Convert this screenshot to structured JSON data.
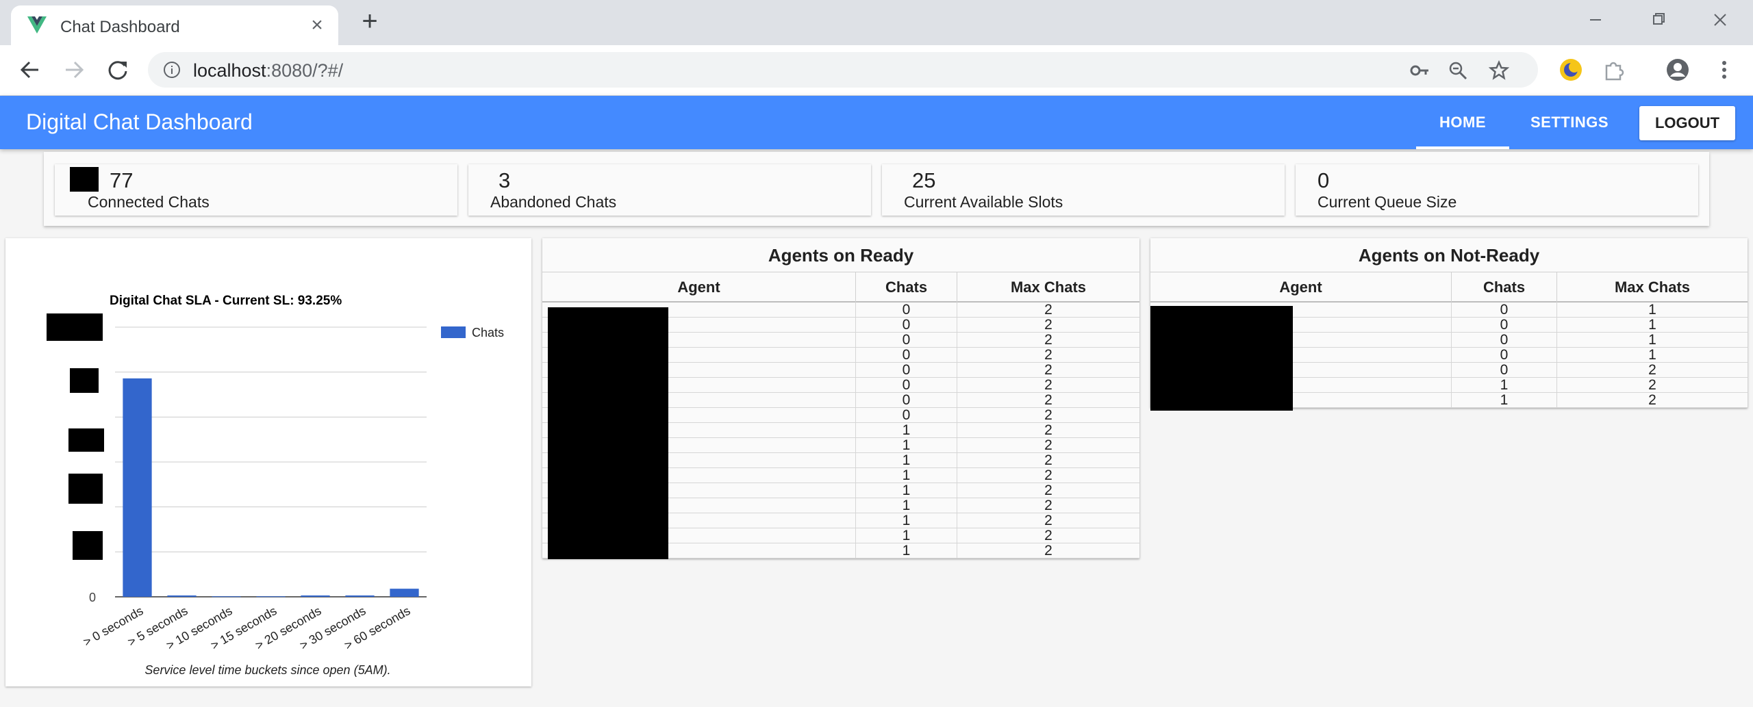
{
  "browser": {
    "tab_title": "Chat Dashboard",
    "url_host": "localhost",
    "url_rest": ":8080/?#/"
  },
  "app": {
    "title": "Digital Chat Dashboard",
    "nav": {
      "home": "HOME",
      "settings": "SETTINGS",
      "logout": "LOGOUT"
    },
    "accent": "#448aff"
  },
  "stats": [
    {
      "value": "77",
      "label": "Connected Chats"
    },
    {
      "value": "3",
      "label": "Abandoned Chats"
    },
    {
      "value": "25",
      "label": "Current Available Slots"
    },
    {
      "value": "0",
      "label": "Current Queue Size"
    }
  ],
  "chart_data": {
    "type": "bar",
    "title": "Digital Chat SLA - Current SL: 93.25%",
    "xlabel": "Service level time buckets since open (5AM).",
    "ylabel": "",
    "categories": [
      "> 0 seconds",
      "> 5 seconds",
      "> 10 seconds",
      "> 15 seconds",
      "> 20 seconds",
      "> 30 seconds",
      "> 60 seconds"
    ],
    "series": [
      {
        "name": "Chats",
        "values": [
          81,
          0.5,
          0.2,
          0.2,
          0.5,
          0.5,
          3
        ],
        "color": "#3366cc"
      }
    ],
    "ylim": [
      0,
      100
    ],
    "y_tick_labels": [
      "0"
    ],
    "grid": true,
    "legend": "right"
  },
  "ready_table": {
    "title": "Agents on Ready",
    "headers": [
      "Agent",
      "Chats",
      "Max Chats"
    ],
    "rows": [
      [
        "0",
        "2"
      ],
      [
        "0",
        "2"
      ],
      [
        "0",
        "2"
      ],
      [
        "0",
        "2"
      ],
      [
        "0",
        "2"
      ],
      [
        "0",
        "2"
      ],
      [
        "0",
        "2"
      ],
      [
        "0",
        "2"
      ],
      [
        "1",
        "2"
      ],
      [
        "1",
        "2"
      ],
      [
        "1",
        "2"
      ],
      [
        "1",
        "2"
      ],
      [
        "1",
        "2"
      ],
      [
        "1",
        "2"
      ],
      [
        "1",
        "2"
      ],
      [
        "1",
        "2"
      ],
      [
        "1",
        "2"
      ]
    ]
  },
  "notready_table": {
    "title": "Agents on Not-Ready",
    "headers": [
      "Agent",
      "Chats",
      "Max Chats"
    ],
    "rows": [
      [
        "0",
        "1"
      ],
      [
        "0",
        "1"
      ],
      [
        "0",
        "1"
      ],
      [
        "0",
        "1"
      ],
      [
        "0",
        "2"
      ],
      [
        "1",
        "2"
      ],
      [
        "1",
        "2"
      ]
    ]
  }
}
